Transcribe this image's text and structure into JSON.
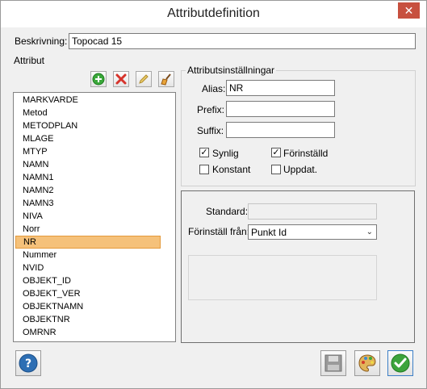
{
  "window": {
    "title": "Attributdefinition",
    "close_glyph": "✕"
  },
  "description": {
    "label": "Beskrivning:",
    "value": "Topocad 15"
  },
  "attributes": {
    "label": "Attribut",
    "items": [
      "MARKVARDE",
      "Metod",
      "METODPLAN",
      "MLAGE",
      "MTYP",
      "NAMN",
      "NAMN1",
      "NAMN2",
      "NAMN3",
      "NIVA",
      "Norr",
      "NR",
      "Nummer",
      "NVID",
      "OBJEKT_ID",
      "OBJEKT_VER",
      "OBJEKTNAMN",
      "OBJEKTNR",
      "OMRNR"
    ],
    "selected": "NR",
    "scroll_up_glyph": "▲",
    "scroll_down_glyph": "▼"
  },
  "toolbar": {
    "add_icon": "plus-circle-icon",
    "delete_icon": "red-x-icon",
    "edit_icon": "pencil-icon",
    "clear_icon": "broom-icon"
  },
  "settings": {
    "group_label": "Attributsinställningar",
    "alias_label": "Alias:",
    "alias_value": "NR",
    "prefix_label": "Prefix:",
    "prefix_value": "",
    "suffix_label": "Suffix:",
    "suffix_value": "",
    "visible_label": "Synlig",
    "visible_checked": true,
    "default_label": "Förinställd",
    "default_checked": true,
    "constant_label": "Konstant",
    "constant_checked": false,
    "update_label": "Uppdat.",
    "update_checked": false
  },
  "defaults": {
    "standard_label": "Standard:",
    "standard_value": "",
    "preset_label": "Förinställ från:",
    "preset_value": "Punkt Id"
  },
  "footer": {
    "help_icon": "help-icon",
    "save_icon": "save-disk-icon",
    "palette_icon": "palette-icon",
    "ok_icon": "checkmark-icon"
  },
  "colors": {
    "selection": "#f5c17a",
    "close": "#c7503f",
    "accent_blue": "#2e6fb4",
    "ok_green": "#3ca43c"
  }
}
